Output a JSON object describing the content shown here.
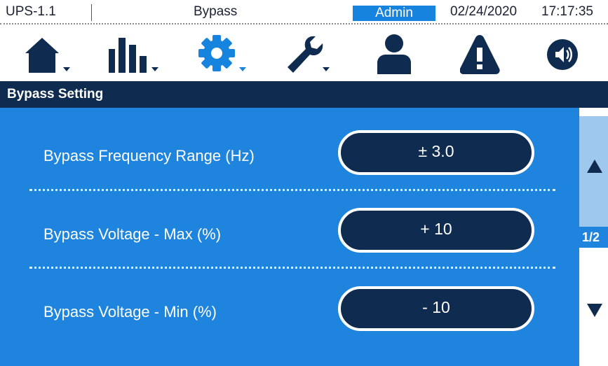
{
  "status": {
    "device": "UPS-1.1",
    "mode": "Bypass",
    "user": "Admin",
    "date": "02/24/2020",
    "time": "17:17:35"
  },
  "icons": [
    "home-icon",
    "chart-icon",
    "settings-icon",
    "wrench-icon",
    "user-icon",
    "warning-icon",
    "speaker-icon"
  ],
  "colors": {
    "navy": "#0f2b4f",
    "blue": "#1e84de",
    "accent": "#1683df",
    "scroll_light": "#9fc8ef"
  },
  "title": "Bypass Setting",
  "settings": [
    {
      "label": "Bypass Frequency Range (Hz)",
      "value": "± 3.0"
    },
    {
      "label": "Bypass Voltage - Max (%)",
      "value": "+ 10"
    },
    {
      "label": "Bypass Voltage - Min (%)",
      "value": "- 10"
    }
  ],
  "pagination": {
    "page": "1/2"
  }
}
